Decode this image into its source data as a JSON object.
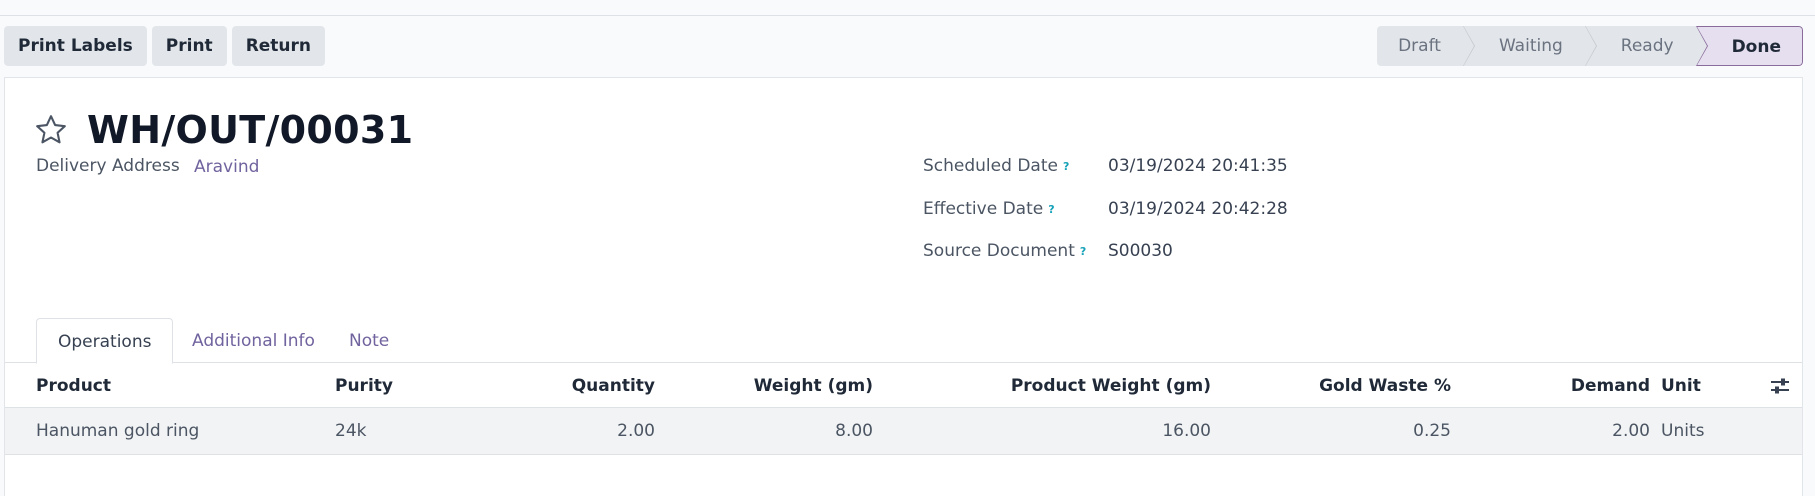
{
  "actions": {
    "print_labels": "Print Labels",
    "print": "Print",
    "return": "Return"
  },
  "status": {
    "stages": [
      "Draft",
      "Waiting",
      "Ready",
      "Done"
    ],
    "active": "Done"
  },
  "record": {
    "title": "WH/OUT/00031",
    "delivery_address_label": "Delivery Address",
    "delivery_address": "Aravind",
    "scheduled_date_label": "Scheduled Date",
    "scheduled_date": "03/19/2024 20:41:35",
    "effective_date_label": "Effective Date",
    "effective_date": "03/19/2024 20:42:28",
    "source_document_label": "Source Document",
    "source_document": "S00030",
    "help_marker": "?"
  },
  "tabs": [
    "Operations",
    "Additional Info",
    "Note"
  ],
  "table": {
    "headers": {
      "product": "Product",
      "purity": "Purity",
      "quantity": "Quantity",
      "weight": "Weight (gm)",
      "product_weight": "Product Weight (gm)",
      "gold_waste": "Gold Waste %",
      "demand": "Demand",
      "unit": "Unit"
    },
    "rows": [
      {
        "product": "Hanuman gold ring",
        "purity": "24k",
        "quantity": "2.00",
        "weight": "8.00",
        "product_weight": "16.00",
        "gold_waste": "0.25",
        "demand": "2.00",
        "unit": "Units"
      }
    ]
  },
  "icons": {
    "star": "star-outline-icon",
    "settings": "optional-columns-icon"
  },
  "colors": {
    "link": "#71639e",
    "active_stage_bg": "#e6dfef",
    "help": "#17a2b8"
  }
}
